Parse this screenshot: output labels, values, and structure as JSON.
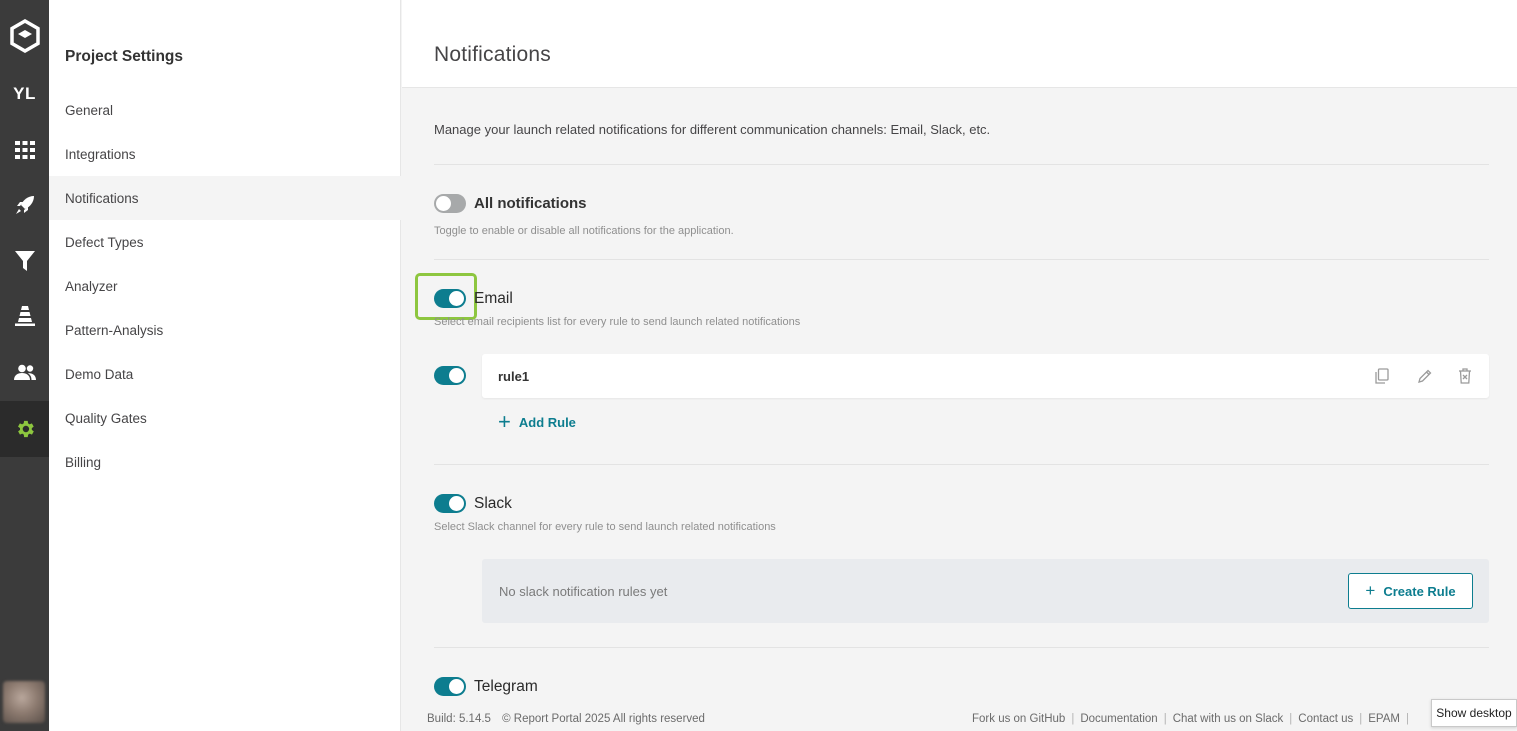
{
  "rail": {
    "project_initials": "YL",
    "items": [
      {
        "icon": "dashboard-grid-icon"
      },
      {
        "icon": "rocket-launches-icon"
      },
      {
        "icon": "filter-icon"
      },
      {
        "icon": "debug-cone-icon"
      },
      {
        "icon": "members-icon"
      },
      {
        "icon": "settings-gear-icon",
        "active": true
      }
    ],
    "accent_color": "#8dc63f"
  },
  "sidebar": {
    "title": "Project Settings",
    "items": [
      {
        "label": "General"
      },
      {
        "label": "Integrations"
      },
      {
        "label": "Notifications",
        "active": true
      },
      {
        "label": "Defect Types"
      },
      {
        "label": "Analyzer"
      },
      {
        "label": "Pattern-Analysis"
      },
      {
        "label": "Demo Data"
      },
      {
        "label": "Quality Gates"
      },
      {
        "label": "Billing"
      }
    ]
  },
  "main": {
    "title": "Notifications",
    "description": "Manage your launch related notifications for different communication channels: Email, Slack, etc.",
    "all_notifications": {
      "label": "All notifications",
      "hint": "Toggle to enable or disable all notifications for the application.",
      "enabled": false
    },
    "email": {
      "label": "Email",
      "hint": "Select email recipients list for every rule to send launch related notifications",
      "enabled": true,
      "rules": [
        {
          "name": "rule1",
          "enabled": true
        }
      ],
      "add_rule_label": "Add Rule"
    },
    "slack": {
      "label": "Slack",
      "hint": "Select Slack channel for every rule to send launch related notifications",
      "enabled": true,
      "empty_text": "No slack notification rules yet",
      "create_rule_label": "Create Rule"
    },
    "telegram": {
      "label": "Telegram",
      "enabled": true
    }
  },
  "footer": {
    "build": "Build: 5.14.5",
    "copyright": "© Report Portal 2025 All rights reserved",
    "links": [
      "Fork us on GitHub",
      "Documentation",
      "Chat with us on Slack",
      "Contact us",
      "EPAM"
    ]
  },
  "tooltip": {
    "text": "Show desktop"
  },
  "colors": {
    "primary": "#0d7d8f",
    "toggle_off": "#a7a9aa",
    "highlight": "#8dc63f"
  }
}
